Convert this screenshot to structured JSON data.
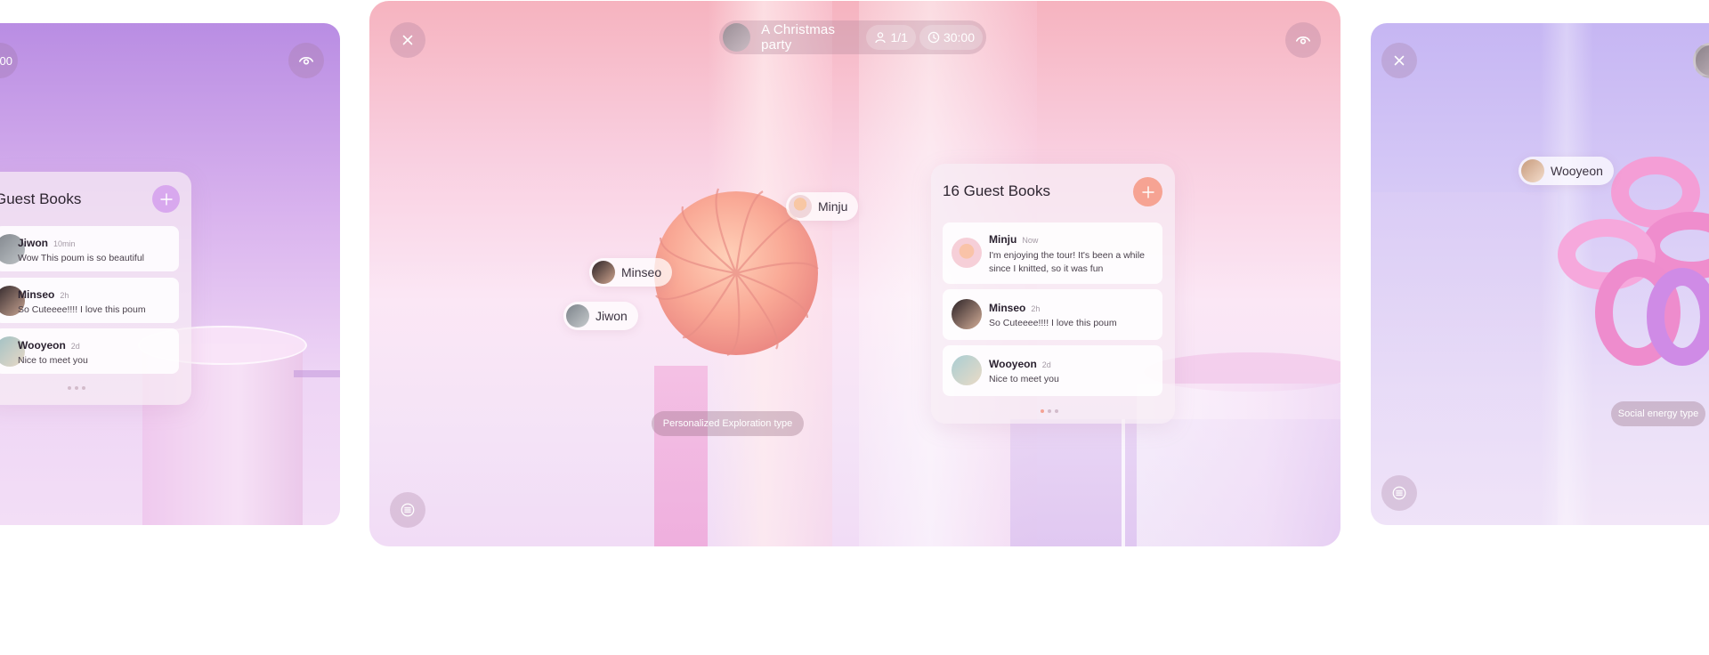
{
  "left_panel": {
    "timer_fragment": "00",
    "guest_books": {
      "title": "Guest Books",
      "comments": [
        {
          "name": "Jiwon",
          "time": "10min",
          "text": "Wow This poum is so beautiful"
        },
        {
          "name": "Minseo",
          "time": "2h",
          "text": "So Cuteeee!!!! I love this poum"
        },
        {
          "name": "Wooyeon",
          "time": "2d",
          "text": "Nice to meet you"
        }
      ]
    }
  },
  "center_panel": {
    "header": {
      "title": "A Christmas party",
      "participants": "1/1",
      "timer": "30:00"
    },
    "name_tags": [
      "Minju",
      "Minseo",
      "Jiwon"
    ],
    "type_label": "Personalized Exploration type",
    "guest_books": {
      "title": "16 Guest Books",
      "comments": [
        {
          "name": "Minju",
          "time": "Now",
          "text_line1": "I'm enjoying the tour! It's been a while",
          "text_line2": "since I knitted, so it was fun"
        },
        {
          "name": "Minseo",
          "time": "2h",
          "text_line1": "So Cuteeee!!!! I love this poum",
          "text_line2": ""
        },
        {
          "name": "Wooyeon",
          "time": "2d",
          "text_line1": "Nice to meet you",
          "text_line2": ""
        }
      ]
    }
  },
  "right_panel": {
    "name_tag": "Wooyeon",
    "type_label": "Social energy type"
  },
  "icons": {
    "close": "close-icon",
    "view": "eye-icon",
    "menu": "menu-icon",
    "add": "plus-icon",
    "participants": "user-icon",
    "timer": "clock-icon"
  },
  "colors": {
    "accent_add": "#f6a393",
    "left_add": "#d6a5ec",
    "white": "#ffffff"
  }
}
